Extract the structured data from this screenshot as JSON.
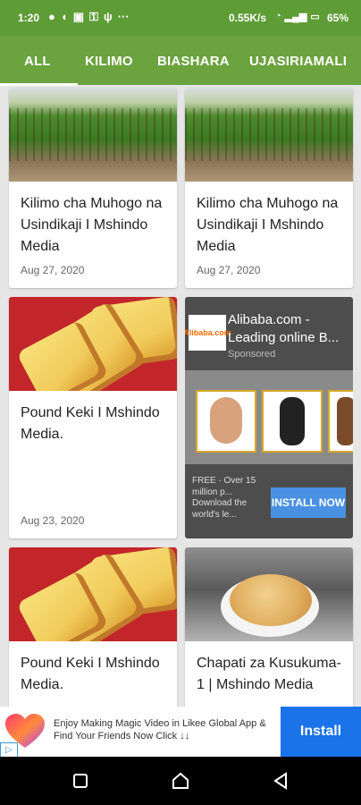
{
  "status_bar": {
    "time": "1:20",
    "speed": "0.55K/s",
    "battery": "65%",
    "left_icons": [
      "circle-icon",
      "chat-icon",
      "image-icon",
      "key-icon",
      "usb-icon",
      "more-icon"
    ],
    "right_icons": [
      "wifi-icon",
      "signal-icon",
      "signal-icon",
      "battery-icon"
    ]
  },
  "tabs": [
    "ALL",
    "KILIMO",
    "BIASHARA",
    "UJASIRIAMALI"
  ],
  "active_tab": "ALL",
  "posts": [
    {
      "title": "Kilimo cha Muhogo na Usindikaji I Mshindo Media",
      "date": "Aug 27, 2020",
      "image": "cassava-field"
    },
    {
      "title": "Kilimo cha Muhogo na Usindikaji I Mshindo Media",
      "date": "Aug 27, 2020",
      "image": "cassava-field"
    },
    {
      "title": "Pound Keki I Mshindo Media.",
      "date": "Aug 23, 2020",
      "image": "pound-cake"
    },
    {
      "title": "Pound Keki I Mshindo Media.",
      "date": "",
      "image": "pound-cake"
    },
    {
      "title": "Chapati za Kusukuma-1 | Mshindo Media",
      "date": "",
      "image": "chapati"
    }
  ],
  "ad": {
    "logo_text": "Alibaba.com",
    "title": "Alibaba.com - Leading online B...",
    "sponsored": "Sponsored",
    "desc": "FREE · Over 15 million p... Download the world's le...",
    "install": "INSTALL NOW"
  },
  "bottom_ad": {
    "text": "Enjoy Making Magic Video in Likee Global App & Find Your Friends Now Click ↓↓",
    "install": "Install",
    "badge": "▷"
  },
  "colors": {
    "status_bar": "#5e9c35",
    "tab_bar": "#6ba33f",
    "install_blue": "#1a73e8"
  }
}
